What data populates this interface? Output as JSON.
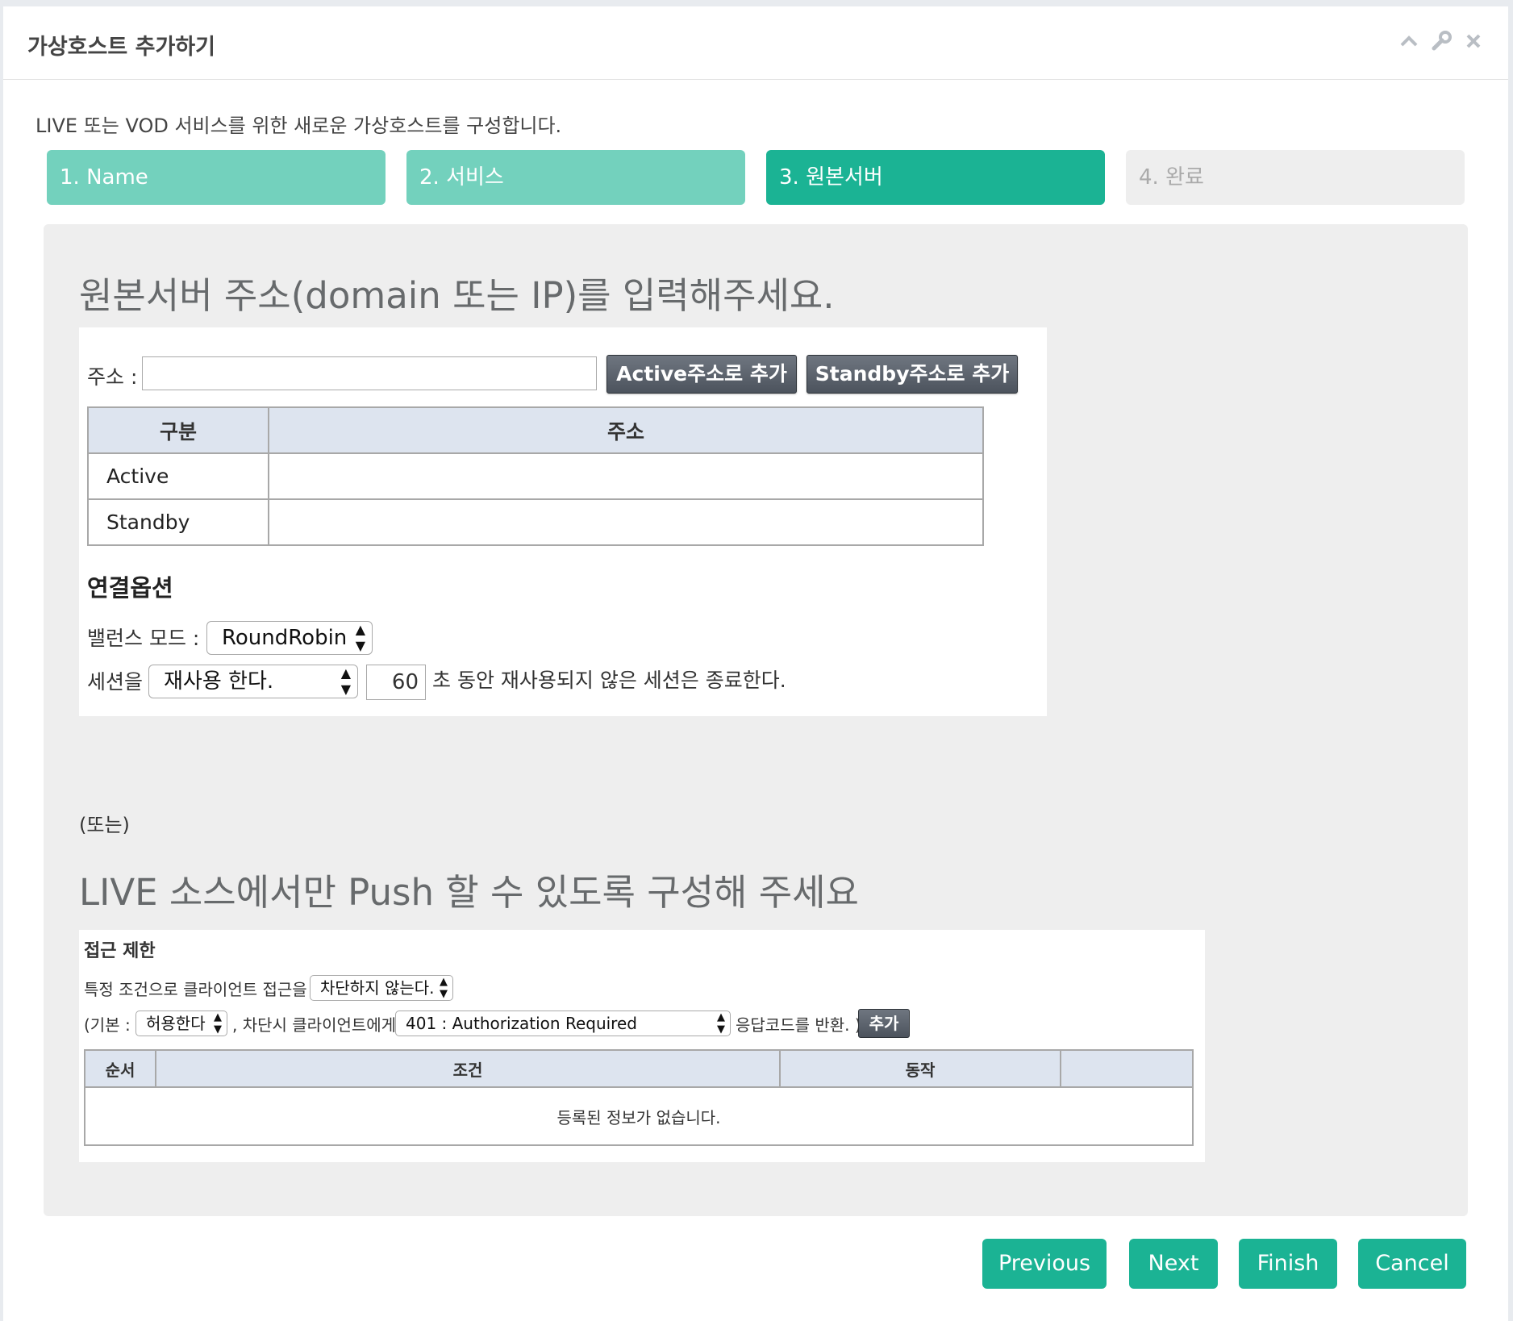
{
  "window": {
    "title": "가상호스트 추가하기",
    "controls": [
      "chevron-up-icon",
      "wrench-icon",
      "close-icon"
    ]
  },
  "intro": "LIVE 또는 VOD 서비스를 위한 새로운 가상호스트를 구성합니다.",
  "steps": [
    {
      "label": "1. Name",
      "state": "done"
    },
    {
      "label": "2. 서비스",
      "state": "done"
    },
    {
      "label": "3. 원본서버",
      "state": "active"
    },
    {
      "label": "4. 완료",
      "state": "todo"
    }
  ],
  "origin": {
    "heading": "원본서버 주소(domain 또는 IP)를 입력해주세요.",
    "address_label": "주소 :",
    "address_value": "",
    "add_active_label": "Active주소로 추가",
    "add_standby_label": "Standby주소로 추가",
    "table": {
      "headers": [
        "구분",
        "주소"
      ],
      "rows": [
        [
          "Active",
          ""
        ],
        [
          "Standby",
          ""
        ]
      ]
    },
    "options_heading": "연결옵션",
    "balance_label": "밸런스 모드 :",
    "balance_value": "RoundRobin",
    "session_label": "세션을",
    "session_value": "재사용 한다.",
    "session_seconds": "60",
    "session_suffix": "초 동안 재사용되지 않은 세션은 종료한다."
  },
  "or_text": "(또는)",
  "push": {
    "heading": "LIVE 소스에서만 Push 할 수 있도록 구성해 주세요",
    "section_title": "접근 제한",
    "line1_prefix": "특정 조건으로 클라이언트 접근을",
    "line1_select": "차단하지 않는다.",
    "line2_prefix": "(기본 :",
    "line2_default": "허용한다",
    "line2_mid": ", 차단시 클라이언트에게",
    "line2_code": "401 : Authorization Required",
    "line2_suffix": "응답코드를 반환. )",
    "add_label": "추가",
    "table": {
      "headers": [
        "순서",
        "조건",
        "동작",
        ""
      ],
      "empty": "등록된 정보가 없습니다."
    }
  },
  "footer": {
    "previous": "Previous",
    "next": "Next",
    "finish": "Finish",
    "cancel": "Cancel"
  },
  "colors": {
    "accent": "#1bb394",
    "step_done": "#73d1bd",
    "step_todo": "#eeeeee",
    "table_header": "#dde4ef"
  }
}
